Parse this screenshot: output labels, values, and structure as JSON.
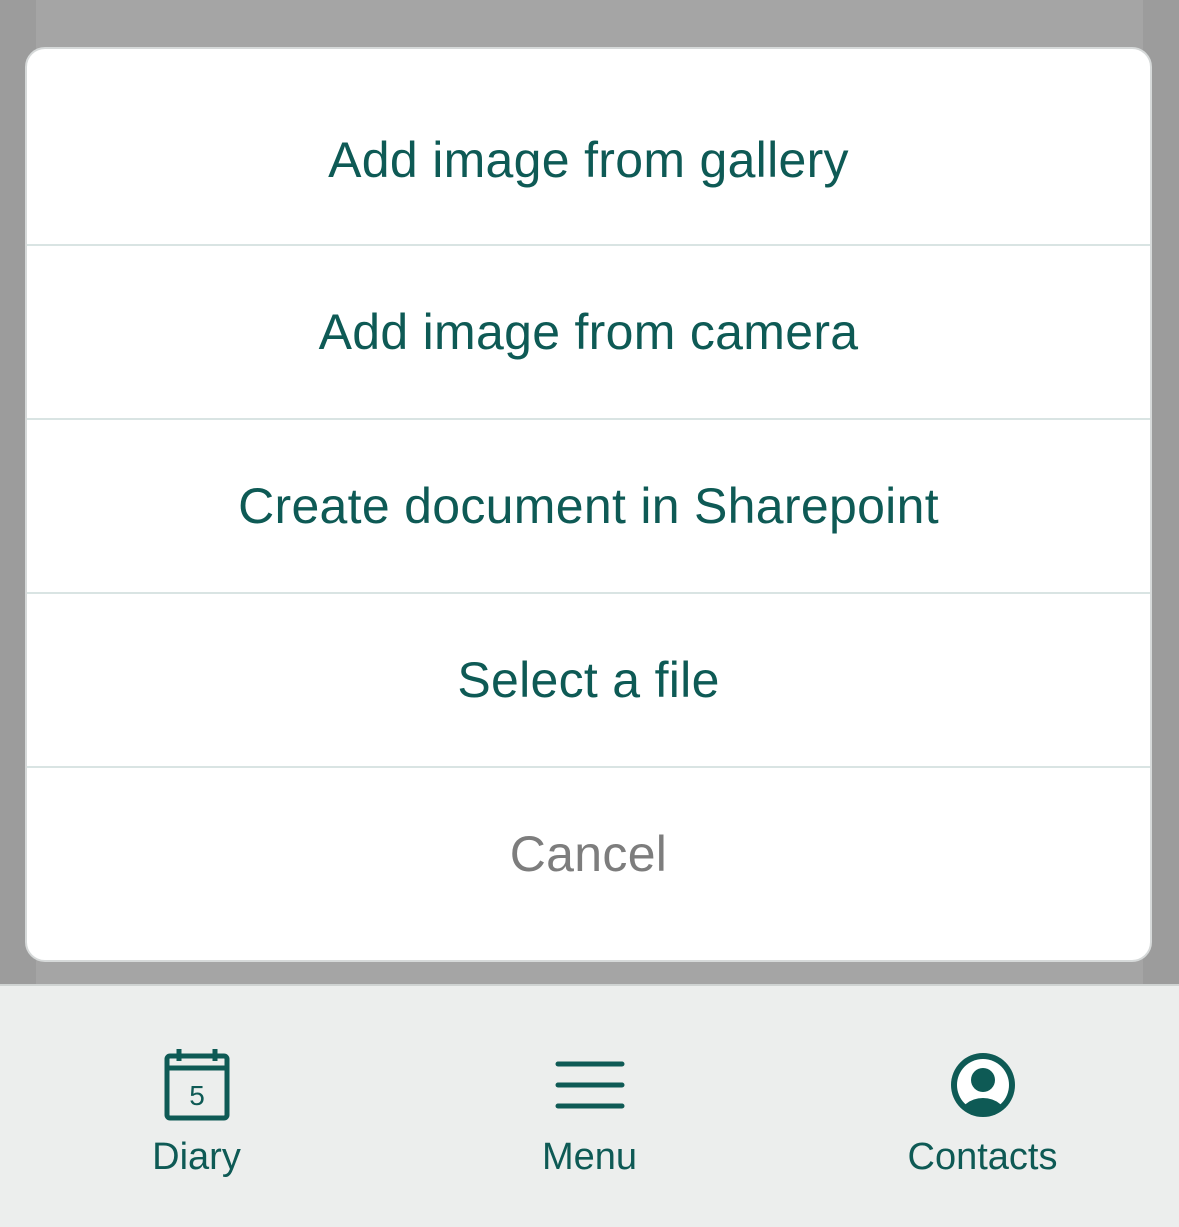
{
  "action_sheet": {
    "items": [
      {
        "label": "Add image from gallery"
      },
      {
        "label": "Add image from camera"
      },
      {
        "label": "Create document in Sharepoint"
      },
      {
        "label": "Select a file"
      }
    ],
    "cancel_label": "Cancel"
  },
  "tab_bar": {
    "tabs": [
      {
        "label": "Diary",
        "icon": "calendar-icon",
        "badge": "5"
      },
      {
        "label": "Menu",
        "icon": "hamburger-menu-icon"
      },
      {
        "label": "Contacts",
        "icon": "user-circle-icon"
      }
    ]
  },
  "colors": {
    "accent": "#0e5a55",
    "cancel": "#7d7d7d",
    "overlay": "#a5a5a5",
    "tab_bar_bg": "#eceeed"
  }
}
